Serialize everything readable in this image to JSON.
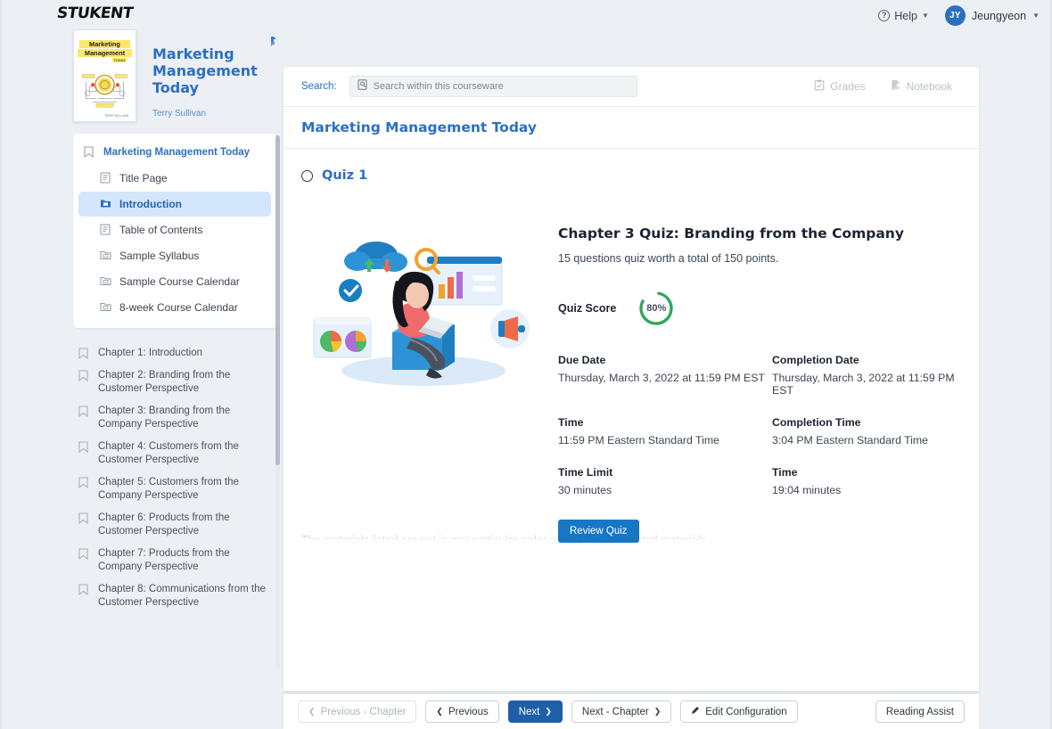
{
  "brand": "STUKENT",
  "header": {
    "help_label": "Help",
    "help_icon": "question-circle-icon",
    "user_initials": "JY",
    "user_name": "Jeungyeon",
    "caret_icon": "chevron-down-icon"
  },
  "course": {
    "title": "Marketing Management Today",
    "author": "Terry Sullivan",
    "cover": {
      "line1": "Marketing",
      "line2": "Management",
      "line3": "TODAY",
      "author": "TERRY SULLIVAN"
    },
    "notebook_flag_icon": "notebook-flag-icon"
  },
  "sidebar": {
    "root_label": "Marketing Management Today",
    "root_icon": "bookmark-icon",
    "items": [
      {
        "label": "Title Page",
        "icon": "document-icon",
        "active": false
      },
      {
        "label": "Introduction",
        "icon": "folder-icon",
        "active": true
      },
      {
        "label": "Table of Contents",
        "icon": "document-icon",
        "active": false
      },
      {
        "label": "Sample Syllabus",
        "icon": "folder-icon",
        "active": false
      },
      {
        "label": "Sample Course Calendar",
        "icon": "folder-icon",
        "active": false
      },
      {
        "label": "8-week Course Calendar",
        "icon": "folder-icon",
        "active": false
      }
    ],
    "chapters": [
      {
        "label": "Chapter 1: Introduction",
        "icon": "bookmark-icon"
      },
      {
        "label": "Chapter 2: Branding from the Customer Perspective",
        "icon": "bookmark-icon"
      },
      {
        "label": "Chapter 3: Branding from the Company Perspective",
        "icon": "bookmark-icon"
      },
      {
        "label": "Chapter 4: Customers from the Customer Perspective",
        "icon": "bookmark-icon"
      },
      {
        "label": "Chapter 5: Customers from the Company Perspective",
        "icon": "bookmark-icon"
      },
      {
        "label": "Chapter 6: Products from the Customer Perspective",
        "icon": "bookmark-icon"
      },
      {
        "label": "Chapter 7: Products from the Company Perspective",
        "icon": "bookmark-icon"
      },
      {
        "label": "Chapter 8: Communications from the Customer Perspective",
        "icon": "bookmark-icon"
      }
    ]
  },
  "search": {
    "label": "Search:",
    "placeholder": "Search within this courseware",
    "value": "",
    "icon": "search-document-icon"
  },
  "tools": {
    "grades_label": "Grades",
    "grades_icon": "clipboard-check-icon",
    "notebook_label": "Notebook",
    "notebook_icon": "notebook-icon"
  },
  "panel": {
    "title": "Marketing Management Today"
  },
  "quiz": {
    "section_label": "Quiz 1",
    "section_icon": "circle-outline-icon",
    "title": "Chapter 3 Quiz: Branding from the Company",
    "subtitle": "15 questions quiz worth a total of 150 points.",
    "score_label": "Quiz Score",
    "score_value": "80%",
    "score_percent": 80,
    "score_color": "#33a65c",
    "fields": [
      {
        "label": "Due Date",
        "value": "Thursday, March 3, 2022 at 11:59 PM  EST"
      },
      {
        "label": "Completion Date",
        "value": "Thursday, March 3, 2022 at 11:59 PM  EST"
      },
      {
        "label": "Time",
        "value": "11:59 PM Eastern Standard Time"
      },
      {
        "label": "Completion Time",
        "value": "3:04 PM Eastern Standard Time"
      },
      {
        "label": "Time Limit",
        "value": "30 minutes"
      },
      {
        "label": "Time",
        "value": "19:04 minutes"
      }
    ],
    "review_button": "Review Quiz",
    "faded_text": "The materials listed are not in any particular order and all the associated materials"
  },
  "bottom_toolbar": {
    "previous_chapter": "Previous - Chapter",
    "previous": "Previous",
    "next": "Next",
    "next_chapter": "Next - Chapter",
    "edit_configuration": "Edit Configuration",
    "reading_assist": "Reading Assist",
    "edit_icon": "pencil-icon"
  },
  "colors": {
    "page_bg": "#eceff3",
    "brand_blue": "#2c6fc2",
    "primary_button": "#1f5fa8",
    "review_button": "#1777c4",
    "active_nav": "#d4e6fb",
    "score_green": "#33a65c"
  }
}
